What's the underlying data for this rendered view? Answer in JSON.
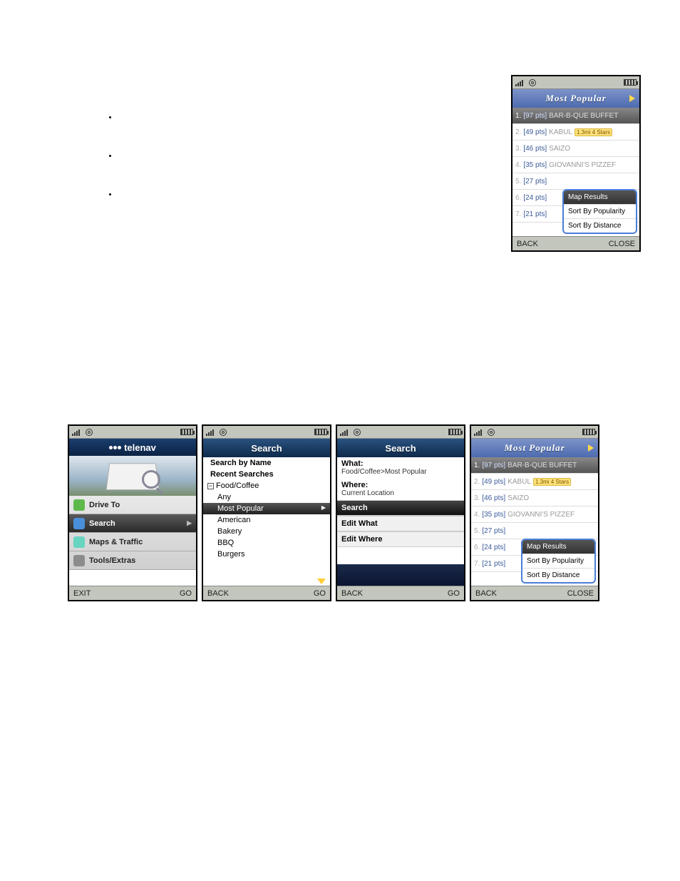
{
  "top_phone": {
    "title": "Most Popular",
    "results": [
      {
        "idx": "1.",
        "pts": "[97 pts]",
        "name": "BAR-B-QUE BUFFET",
        "selected": true
      },
      {
        "idx": "2.",
        "pts": "[49 pts]",
        "name": "KABUL",
        "badge": "1.3mi 4 Stars"
      },
      {
        "idx": "3.",
        "pts": "[46 pts]",
        "name": "SAIZO"
      },
      {
        "idx": "4.",
        "pts": "[35 pts]",
        "name": "GIOVANNI'S PIZZEF"
      },
      {
        "idx": "5.",
        "pts": "[27 pts]",
        "name": ""
      },
      {
        "idx": "6.",
        "pts": "[24 pts]",
        "name": ""
      },
      {
        "idx": "7.",
        "pts": "[21 pts]",
        "name": ""
      }
    ],
    "popup": {
      "items": [
        {
          "label": "Map Results",
          "selected": true
        },
        {
          "label": "Sort By Popularity"
        },
        {
          "label": "Sort By Distance"
        }
      ]
    },
    "soft_left": "BACK",
    "soft_right": "CLOSE"
  },
  "row_phones": {
    "s1": {
      "logo": "telenav",
      "menu": [
        {
          "label": "Drive To",
          "icon_color": "#5fb94a"
        },
        {
          "label": "Search",
          "icon_color": "#4a8fd9",
          "selected": true
        },
        {
          "label": "Maps & Traffic",
          "icon_color": "#67d5c0"
        },
        {
          "label": "Tools/Extras",
          "icon_color": "#8c8c8c"
        }
      ],
      "soft_left": "EXIT",
      "soft_right": "GO"
    },
    "s2": {
      "title": "Search",
      "top_items": [
        "Search by Name",
        "Recent Searches"
      ],
      "node": "Food/Coffee",
      "subs": [
        {
          "label": "Any"
        },
        {
          "label": "Most Popular",
          "selected": true
        },
        {
          "label": "American"
        },
        {
          "label": "Bakery"
        },
        {
          "label": "BBQ"
        },
        {
          "label": "Burgers"
        }
      ],
      "soft_left": "BACK",
      "soft_right": "GO"
    },
    "s3": {
      "title": "Search",
      "what_label": "What:",
      "what_value": "Food/Coffee>Most Popular",
      "where_label": "Where:",
      "where_value": "Current Location",
      "actions": [
        {
          "label": "Search",
          "selected": true
        },
        {
          "label": "Edit What"
        },
        {
          "label": "Edit Where"
        }
      ],
      "soft_left": "BACK",
      "soft_right": "GO"
    },
    "s4": {
      "title": "Most Popular",
      "results": [
        {
          "idx": "1.",
          "pts": "[97 pts]",
          "name": "BAR-B-QUE BUFFET",
          "selected": true
        },
        {
          "idx": "2.",
          "pts": "[49 pts]",
          "name": "KABUL",
          "badge": "1.3mi 4 Stars"
        },
        {
          "idx": "3.",
          "pts": "[46 pts]",
          "name": "SAIZO"
        },
        {
          "idx": "4.",
          "pts": "[35 pts]",
          "name": "GIOVANNI'S PIZZEF"
        },
        {
          "idx": "5.",
          "pts": "[27 pts]",
          "name": ""
        },
        {
          "idx": "6.",
          "pts": "[24 pts]",
          "name": ""
        },
        {
          "idx": "7.",
          "pts": "[21 pts]",
          "name": ""
        }
      ],
      "popup": {
        "items": [
          {
            "label": "Map Results",
            "selected": true
          },
          {
            "label": "Sort By Popularity"
          },
          {
            "label": "Sort By Distance"
          }
        ]
      },
      "soft_left": "BACK",
      "soft_right": "CLOSE"
    }
  }
}
